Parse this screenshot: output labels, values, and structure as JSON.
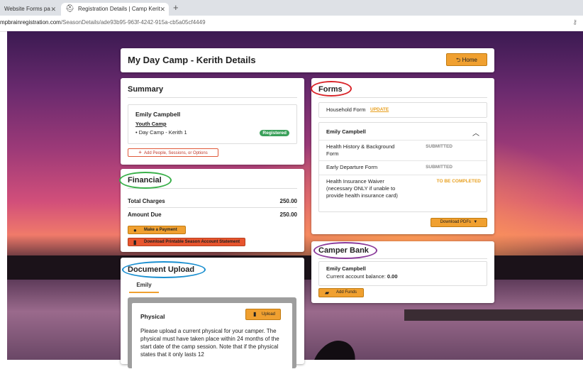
{
  "browser": {
    "tabs": [
      {
        "label": "Website Forms pa",
        "active": false
      },
      {
        "label": "Registration Details | Camp Kerit",
        "active": true
      }
    ],
    "url_host": "mpbrainregistration.com",
    "url_path": "/SeasonDetails/ade93b95-963f-4242-915a-cb5a05cf4449"
  },
  "header": {
    "title": "My Day Camp - Kerith Details",
    "home_label": "Home"
  },
  "summary": {
    "title": "Summary",
    "camper_name": "Emily Campbell",
    "program": "Youth Camp",
    "session": "Day Camp - Kerith 1",
    "status_badge": "Registered",
    "add_button": "Add People, Sessions, or Options"
  },
  "financial": {
    "title": "Financial",
    "total_charges_label": "Total Charges",
    "total_charges_value": "250.00",
    "amount_due_label": "Amount Due",
    "amount_due_value": "250.00",
    "payment_button": "Make a Payment",
    "statement_button": "Download Printable Season Account Statement"
  },
  "document_upload": {
    "title": "Document Upload",
    "tab": "Emily",
    "physical_title": "Physical",
    "upload_button": "Upload",
    "physical_text": "Please upload a current physical for your camper. The physical must have taken place within 24 months of the start date of the camp session. Note that if the physical states that it only lasts 12"
  },
  "forms": {
    "title": "Forms",
    "household_form": "Household Form",
    "update_link": "UPDATE",
    "camper_name": "Emily Campbell",
    "items": [
      {
        "name": "Health History & Background Form",
        "status": "SUBMITTED"
      },
      {
        "name": "Early Departure Form",
        "status": "SUBMITTED"
      },
      {
        "name": "Health Insurance Waiver (necessary ONLY if unable to provide health insurance card)",
        "status": "TO BE COMPLETED"
      }
    ],
    "download_button": "Download PDFs"
  },
  "camper_bank": {
    "title": "Camper Bank",
    "camper_name": "Emily Campbell",
    "balance_label": "Current account balance:",
    "balance_value": "0.00",
    "add_funds_button": "Add Funds"
  },
  "colors": {
    "accent_orange": "#f0a030",
    "submit_red": "#e8552e",
    "registered_green": "#3aa05a",
    "highlight_red": "#d9252a",
    "highlight_green": "#3ab04a",
    "highlight_blue": "#1a8fd0",
    "highlight_purple": "#8a3a9a"
  }
}
